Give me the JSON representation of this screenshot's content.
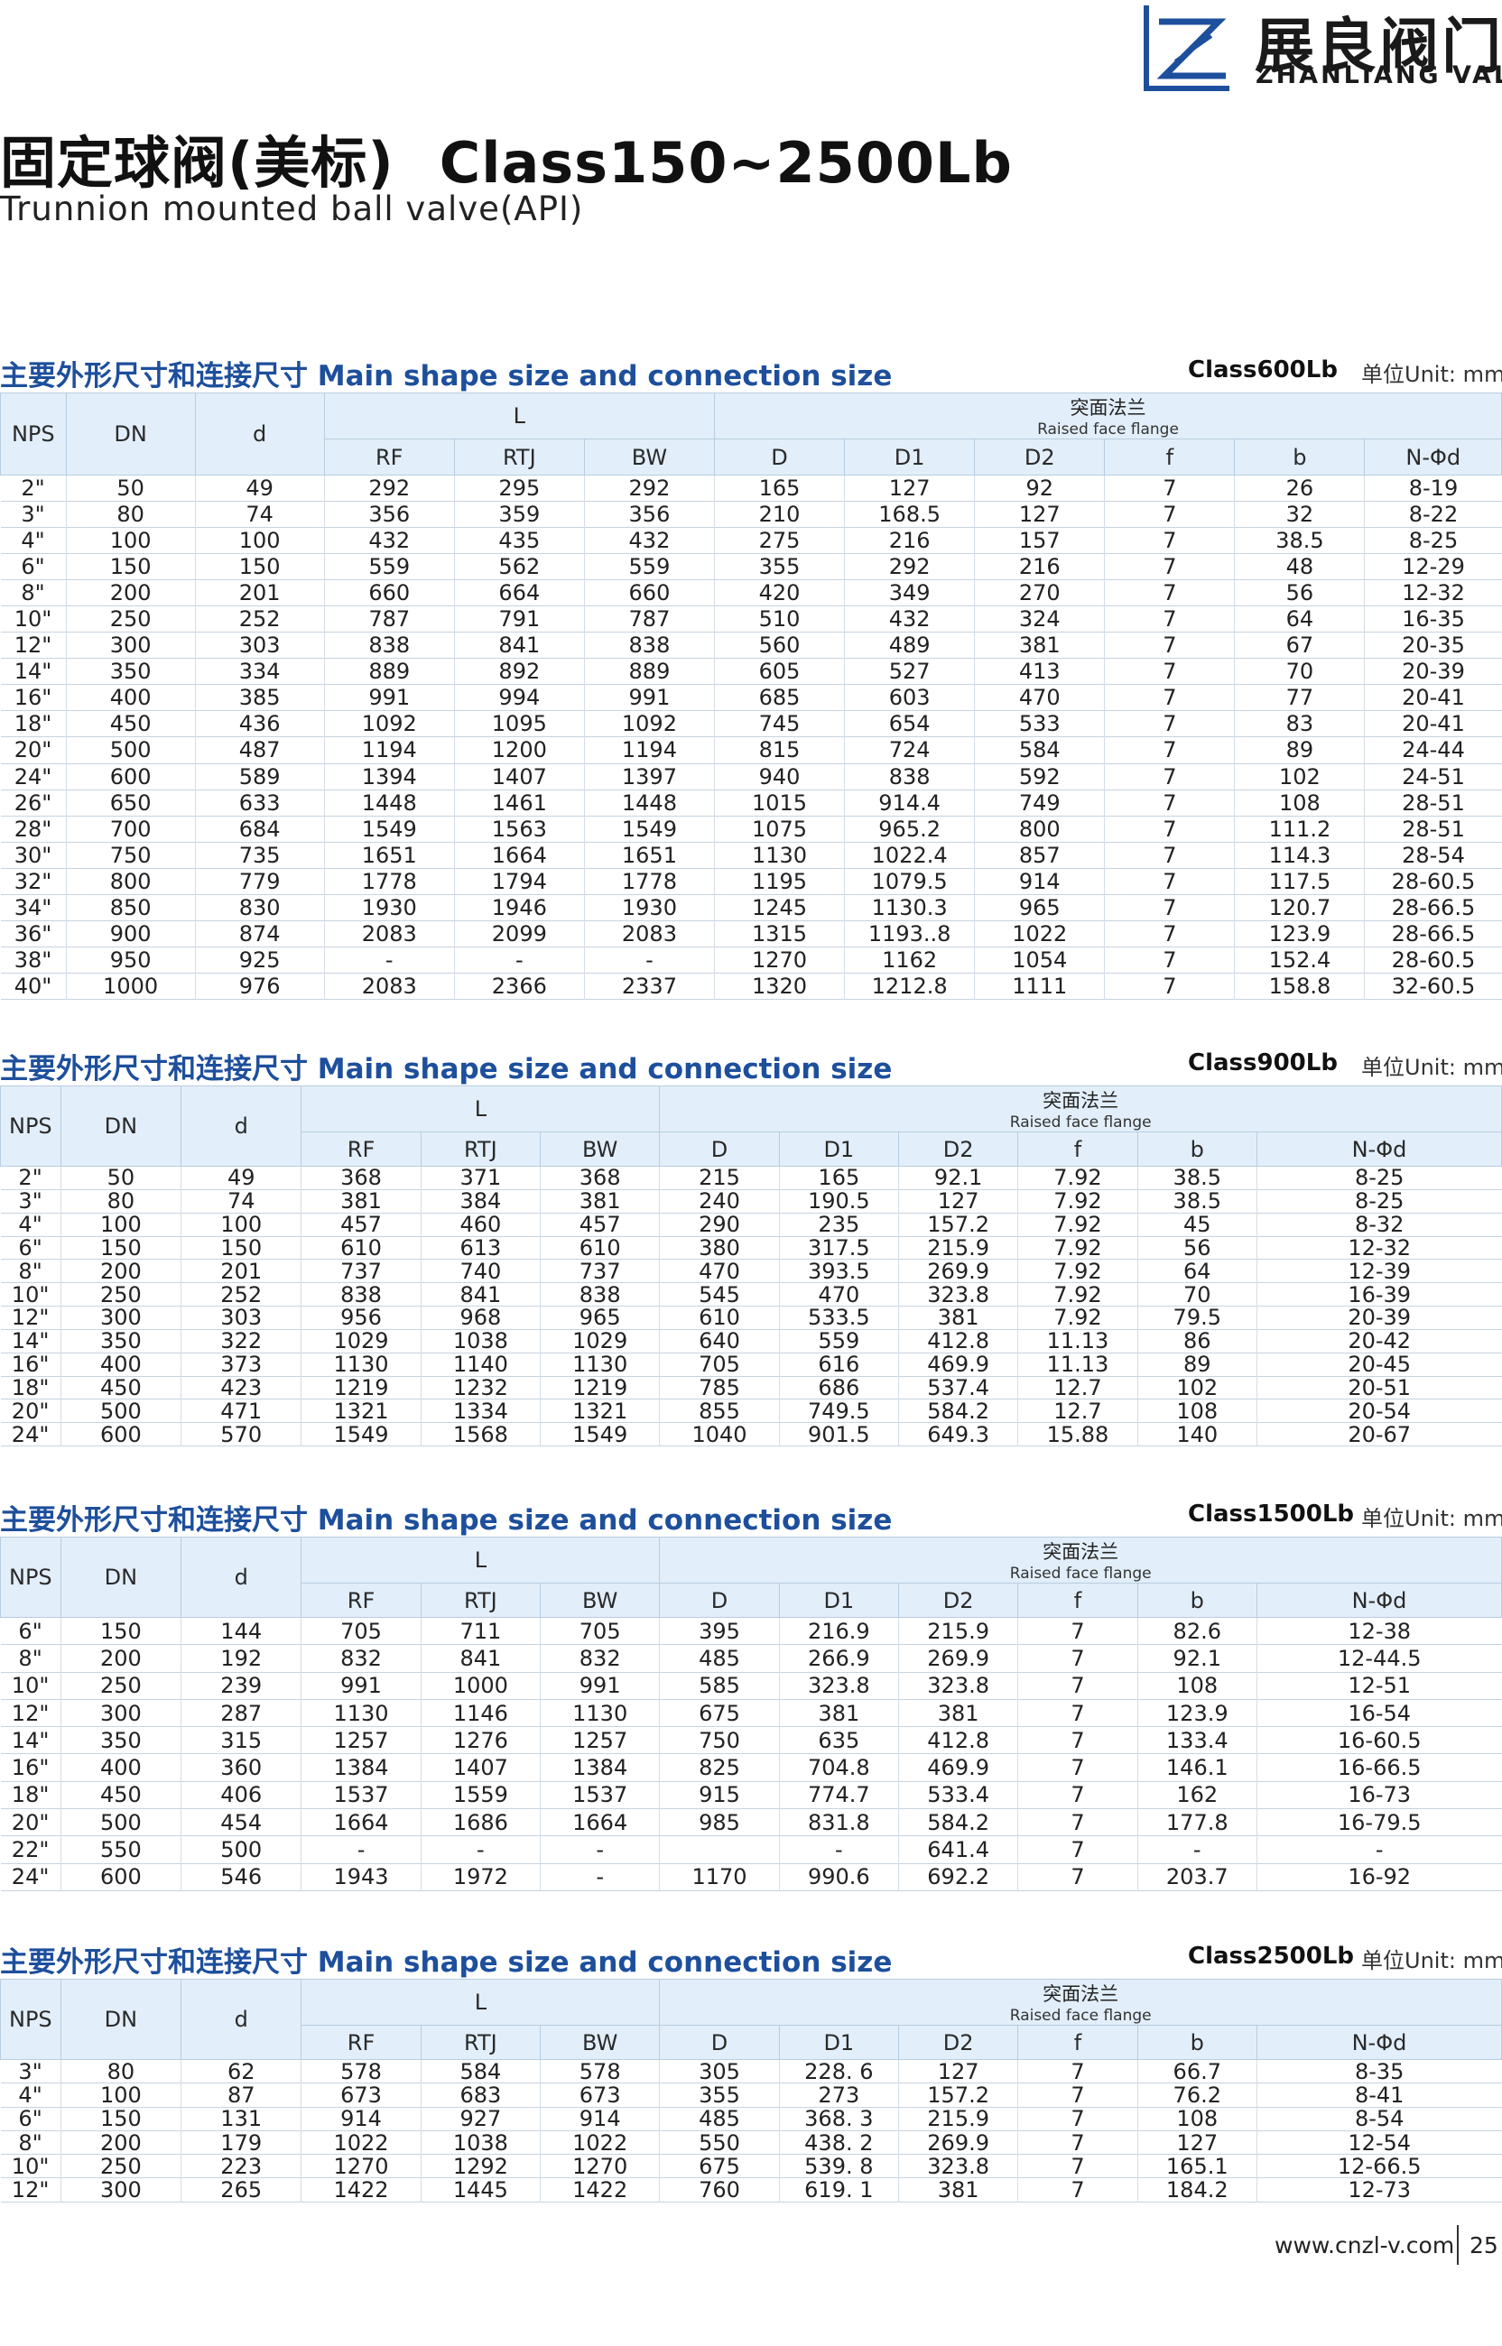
{
  "brand": {
    "name_cn": "展良阀门",
    "name_en": "ZHANLIANG VALVE"
  },
  "title": {
    "cn": "固定球阀(美标)",
    "class_range": "Class150~2500Lb",
    "en": "Trunnion mounted ball valve(API)"
  },
  "common": {
    "section_title": "主要外形尺寸和连接尺寸 Main shape size and connection size",
    "unit": "单位Unit: mm",
    "head_nps": "NPS",
    "head_dn": "DN",
    "head_d": "d",
    "head_L": "L",
    "head_rf": "RF",
    "head_rtj": "RTJ",
    "head_bw": "BW",
    "flange_cn": "突面法兰",
    "flange_en": "Raised face flange",
    "head_D": "D",
    "head_D1": "D1",
    "head_D2": "D2",
    "head_f": "f",
    "head_b": "b",
    "head_nd": "N-Φd"
  },
  "tables": [
    {
      "class_label": "Class600Lb",
      "rows": [
        [
          "2\"",
          "50",
          "49",
          "292",
          "295",
          "292",
          "165",
          "127",
          "92",
          "7",
          "26",
          "8-19"
        ],
        [
          "3\"",
          "80",
          "74",
          "356",
          "359",
          "356",
          "210",
          "168.5",
          "127",
          "7",
          "32",
          "8-22"
        ],
        [
          "4\"",
          "100",
          "100",
          "432",
          "435",
          "432",
          "275",
          "216",
          "157",
          "7",
          "38.5",
          "8-25"
        ],
        [
          "6\"",
          "150",
          "150",
          "559",
          "562",
          "559",
          "355",
          "292",
          "216",
          "7",
          "48",
          "12-29"
        ],
        [
          "8\"",
          "200",
          "201",
          "660",
          "664",
          "660",
          "420",
          "349",
          "270",
          "7",
          "56",
          "12-32"
        ],
        [
          "10\"",
          "250",
          "252",
          "787",
          "791",
          "787",
          "510",
          "432",
          "324",
          "7",
          "64",
          "16-35"
        ],
        [
          "12\"",
          "300",
          "303",
          "838",
          "841",
          "838",
          "560",
          "489",
          "381",
          "7",
          "67",
          "20-35"
        ],
        [
          "14\"",
          "350",
          "334",
          "889",
          "892",
          "889",
          "605",
          "527",
          "413",
          "7",
          "70",
          "20-39"
        ],
        [
          "16\"",
          "400",
          "385",
          "991",
          "994",
          "991",
          "685",
          "603",
          "470",
          "7",
          "77",
          "20-41"
        ],
        [
          "18\"",
          "450",
          "436",
          "1092",
          "1095",
          "1092",
          "745",
          "654",
          "533",
          "7",
          "83",
          "20-41"
        ],
        [
          "20\"",
          "500",
          "487",
          "1194",
          "1200",
          "1194",
          "815",
          "724",
          "584",
          "7",
          "89",
          "24-44"
        ],
        [
          "24\"",
          "600",
          "589",
          "1394",
          "1407",
          "1397",
          "940",
          "838",
          "592",
          "7",
          "102",
          "24-51"
        ],
        [
          "26\"",
          "650",
          "633",
          "1448",
          "1461",
          "1448",
          "1015",
          "914.4",
          "749",
          "7",
          "108",
          "28-51"
        ],
        [
          "28\"",
          "700",
          "684",
          "1549",
          "1563",
          "1549",
          "1075",
          "965.2",
          "800",
          "7",
          "111.2",
          "28-51"
        ],
        [
          "30\"",
          "750",
          "735",
          "1651",
          "1664",
          "1651",
          "1130",
          "1022.4",
          "857",
          "7",
          "114.3",
          "28-54"
        ],
        [
          "32\"",
          "800",
          "779",
          "1778",
          "1794",
          "1778",
          "1195",
          "1079.5",
          "914",
          "7",
          "117.5",
          "28-60.5"
        ],
        [
          "34\"",
          "850",
          "830",
          "1930",
          "1946",
          "1930",
          "1245",
          "1130.3",
          "965",
          "7",
          "120.7",
          "28-66.5"
        ],
        [
          "36\"",
          "900",
          "874",
          "2083",
          "2099",
          "2083",
          "1315",
          "1193..8",
          "1022",
          "7",
          "123.9",
          "28-66.5"
        ],
        [
          "38\"",
          "950",
          "925",
          "-",
          "-",
          "-",
          "1270",
          "1162",
          "1054",
          "7",
          "152.4",
          "28-60.5"
        ],
        [
          "40\"",
          "1000",
          "976",
          "2083",
          "2366",
          "2337",
          "1320",
          "1212.8",
          "1111",
          "7",
          "158.8",
          "32-60.5"
        ]
      ]
    },
    {
      "class_label": "Class900Lb",
      "rows": [
        [
          "2\"",
          "50",
          "49",
          "368",
          "371",
          "368",
          "215",
          "165",
          "92.1",
          "7.92",
          "38.5",
          "8-25"
        ],
        [
          "3\"",
          "80",
          "74",
          "381",
          "384",
          "381",
          "240",
          "190.5",
          "127",
          "7.92",
          "38.5",
          "8-25"
        ],
        [
          "4\"",
          "100",
          "100",
          "457",
          "460",
          "457",
          "290",
          "235",
          "157.2",
          "7.92",
          "45",
          "8-32"
        ],
        [
          "6\"",
          "150",
          "150",
          "610",
          "613",
          "610",
          "380",
          "317.5",
          "215.9",
          "7.92",
          "56",
          "12-32"
        ],
        [
          "8\"",
          "200",
          "201",
          "737",
          "740",
          "737",
          "470",
          "393.5",
          "269.9",
          "7.92",
          "64",
          "12-39"
        ],
        [
          "10\"",
          "250",
          "252",
          "838",
          "841",
          "838",
          "545",
          "470",
          "323.8",
          "7.92",
          "70",
          "16-39"
        ],
        [
          "12\"",
          "300",
          "303",
          "956",
          "968",
          "965",
          "610",
          "533.5",
          "381",
          "7.92",
          "79.5",
          "20-39"
        ],
        [
          "14\"",
          "350",
          "322",
          "1029",
          "1038",
          "1029",
          "640",
          "559",
          "412.8",
          "11.13",
          "86",
          "20-42"
        ],
        [
          "16\"",
          "400",
          "373",
          "1130",
          "1140",
          "1130",
          "705",
          "616",
          "469.9",
          "11.13",
          "89",
          "20-45"
        ],
        [
          "18\"",
          "450",
          "423",
          "1219",
          "1232",
          "1219",
          "785",
          "686",
          "537.4",
          "12.7",
          "102",
          "20-51"
        ],
        [
          "20\"",
          "500",
          "471",
          "1321",
          "1334",
          "1321",
          "855",
          "749.5",
          "584.2",
          "12.7",
          "108",
          "20-54"
        ],
        [
          "24\"",
          "600",
          "570",
          "1549",
          "1568",
          "1549",
          "1040",
          "901.5",
          "649.3",
          "15.88",
          "140",
          "20-67"
        ]
      ]
    },
    {
      "class_label": "Class1500Lb",
      "rows": [
        [
          "6\"",
          "150",
          "144",
          "705",
          "711",
          "705",
          "395",
          "216.9",
          "215.9",
          "7",
          "82.6",
          "12-38"
        ],
        [
          "8\"",
          "200",
          "192",
          "832",
          "841",
          "832",
          "485",
          "266.9",
          "269.9",
          "7",
          "92.1",
          "12-44.5"
        ],
        [
          "10\"",
          "250",
          "239",
          "991",
          "1000",
          "991",
          "585",
          "323.8",
          "323.8",
          "7",
          "108",
          "12-51"
        ],
        [
          "12\"",
          "300",
          "287",
          "1130",
          "1146",
          "1130",
          "675",
          "381",
          "381",
          "7",
          "123.9",
          "16-54"
        ],
        [
          "14\"",
          "350",
          "315",
          "1257",
          "1276",
          "1257",
          "750",
          "635",
          "412.8",
          "7",
          "133.4",
          "16-60.5"
        ],
        [
          "16\"",
          "400",
          "360",
          "1384",
          "1407",
          "1384",
          "825",
          "704.8",
          "469.9",
          "7",
          "146.1",
          "16-66.5"
        ],
        [
          "18\"",
          "450",
          "406",
          "1537",
          "1559",
          "1537",
          "915",
          "774.7",
          "533.4",
          "7",
          "162",
          "16-73"
        ],
        [
          "20\"",
          "500",
          "454",
          "1664",
          "1686",
          "1664",
          "985",
          "831.8",
          "584.2",
          "7",
          "177.8",
          "16-79.5"
        ],
        [
          "22\"",
          "550",
          "500",
          "-",
          "-",
          "-",
          "",
          "-",
          "641.4",
          "7",
          "-",
          "-"
        ],
        [
          "24\"",
          "600",
          "546",
          "1943",
          "1972",
          "-",
          "1170",
          "990.6",
          "692.2",
          "7",
          "203.7",
          "16-92"
        ]
      ]
    },
    {
      "class_label": "Class2500Lb",
      "rows": [
        [
          "3\"",
          "80",
          "62",
          "578",
          "584",
          "578",
          "305",
          "228. 6",
          "127",
          "7",
          "66.7",
          "8-35"
        ],
        [
          "4\"",
          "100",
          "87",
          "673",
          "683",
          "673",
          "355",
          "273",
          "157.2",
          "7",
          "76.2",
          "8-41"
        ],
        [
          "6\"",
          "150",
          "131",
          "914",
          "927",
          "914",
          "485",
          "368. 3",
          "215.9",
          "7",
          "108",
          "8-54"
        ],
        [
          "8\"",
          "200",
          "179",
          "1022",
          "1038",
          "1022",
          "550",
          "438. 2",
          "269.9",
          "7",
          "127",
          "12-54"
        ],
        [
          "10\"",
          "250",
          "223",
          "1270",
          "1292",
          "1270",
          "675",
          "539. 8",
          "323.8",
          "7",
          "165.1",
          "12-66.5"
        ],
        [
          "12\"",
          "300",
          "265",
          "1422",
          "1445",
          "1422",
          "760",
          "619. 1",
          "381",
          "7",
          "184.2",
          "12-73"
        ]
      ]
    }
  ],
  "footer": {
    "url": "www.cnzl-v.com",
    "page": "25"
  }
}
